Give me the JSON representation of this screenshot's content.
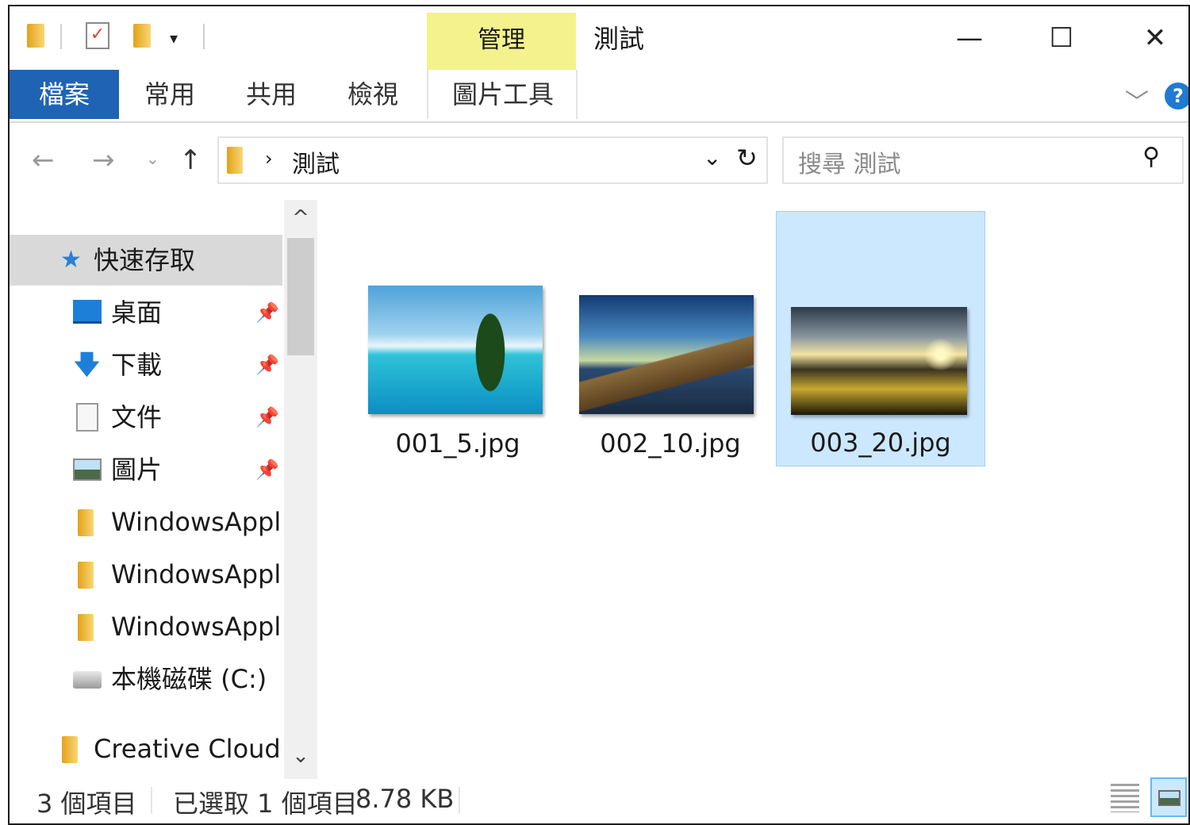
{
  "window": {
    "title": "測試",
    "contextual_tab_header": "管理",
    "controls": {
      "minimize": "—",
      "maximize": "☐",
      "close": "✕"
    }
  },
  "ribbon": {
    "tabs": [
      {
        "label": "檔案",
        "active": true
      },
      {
        "label": "常用"
      },
      {
        "label": "共用"
      },
      {
        "label": "檢視"
      },
      {
        "label": "圖片工具"
      }
    ],
    "help": "?"
  },
  "nav": {
    "breadcrumb": "測試",
    "search_placeholder": "搜尋 測試"
  },
  "sidebar": {
    "quick_access": "快速存取",
    "items": [
      {
        "label": "桌面",
        "icon": "desktop-icon",
        "pinned": true
      },
      {
        "label": "下載",
        "icon": "download-icon",
        "pinned": true
      },
      {
        "label": "文件",
        "icon": "document-icon",
        "pinned": true
      },
      {
        "label": "圖片",
        "icon": "pictures-icon",
        "pinned": true
      },
      {
        "label": "WindowsApplic",
        "icon": "folder-icon"
      },
      {
        "label": "WindowsApplic",
        "icon": "folder-icon"
      },
      {
        "label": "WindowsApplic",
        "icon": "folder-icon"
      },
      {
        "label": "本機磁碟 (C:)",
        "icon": "drive-icon"
      }
    ],
    "creative_cloud": "Creative Cloud Fi"
  },
  "files": [
    {
      "name": "001_5.jpg",
      "selected": false
    },
    {
      "name": "002_10.jpg",
      "selected": false
    },
    {
      "name": "003_20.jpg",
      "selected": true
    }
  ],
  "status": {
    "count": "3 個項目",
    "selection": "已選取 1 個項目",
    "size": "8.78 KB"
  },
  "colors": {
    "file_tab": "#1f63b5",
    "manage_tab": "#f4f28c",
    "selection": "#cce8ff",
    "help": "#1f7ad1"
  }
}
